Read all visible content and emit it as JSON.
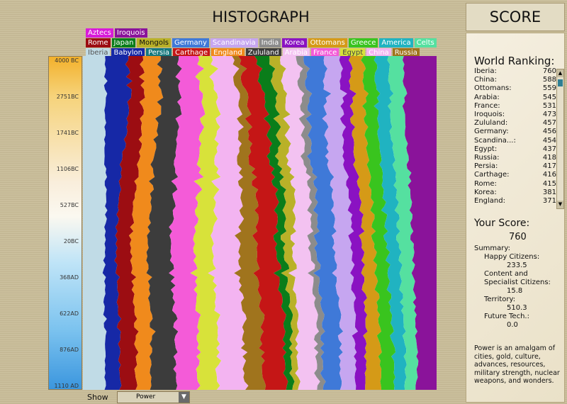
{
  "header": {
    "histograph_title": "HISTOGRAPH",
    "score_title": "SCORE"
  },
  "legend": {
    "row1": [
      {
        "label": "Aztecs",
        "color": "#d81bd8",
        "text": "#ffffff"
      },
      {
        "label": "Iroquois",
        "color": "#8a139a",
        "text": "#ffffff"
      }
    ],
    "row2": [
      {
        "label": "Rome",
        "color": "#9c0d12",
        "text": "#ffffff"
      },
      {
        "label": "Japan",
        "color": "#0a7d1a",
        "text": "#ffffff"
      },
      {
        "label": "Mongols",
        "color": "#b9b128",
        "text": "#111111"
      },
      {
        "label": "Germany",
        "color": "#3f79d8",
        "text": "#ffffff"
      },
      {
        "label": "Scandinavia",
        "color": "#c6a6f0",
        "text": "#ffffff"
      },
      {
        "label": "India",
        "color": "#8c8c8c",
        "text": "#ffffff"
      },
      {
        "label": "Korea",
        "color": "#8a12c2",
        "text": "#ffffff"
      },
      {
        "label": "Ottomans",
        "color": "#d59a17",
        "text": "#ffffff"
      },
      {
        "label": "Greece",
        "color": "#39c41e",
        "text": "#ffffff"
      },
      {
        "label": "America",
        "color": "#20b3c1",
        "text": "#ffffff"
      },
      {
        "label": "Celts",
        "color": "#55e0a0",
        "text": "#ffffff"
      }
    ],
    "row3": [
      {
        "label": "Iberia",
        "color": "#c0dbe6",
        "text": "#555555"
      },
      {
        "label": "Babylon",
        "color": "#1628a6",
        "text": "#ffffff"
      },
      {
        "label": "Persia",
        "color": "#16797e",
        "text": "#ffffff"
      },
      {
        "label": "Carthage",
        "color": "#c51616",
        "text": "#ffffff"
      },
      {
        "label": "England",
        "color": "#f08a1c",
        "text": "#ffffff"
      },
      {
        "label": "Zululand",
        "color": "#3c3c3c",
        "text": "#ffffff"
      },
      {
        "label": "Arabia",
        "color": "#f3c2f1",
        "text": "#ffffff"
      },
      {
        "label": "France",
        "color": "#f45bd8",
        "text": "#ffffff"
      },
      {
        "label": "Egypt",
        "color": "#d8e23a",
        "text": "#444444"
      },
      {
        "label": "China",
        "color": "#f3b4f1",
        "text": "#ffffff"
      },
      {
        "label": "Russia",
        "color": "#a0741d",
        "text": "#ffffff"
      }
    ]
  },
  "chart_data": {
    "type": "area",
    "title": "HISTOGRAPH",
    "x_axis_ticks": [
      "4000 BC",
      "2751BC",
      "1741BC",
      "1106BC",
      "527BC",
      "20BC",
      "368AD",
      "622AD",
      "876AD",
      "1110 AD"
    ],
    "series": [
      {
        "name": "Iberia",
        "color": "#c0dbe6",
        "values": [
          30,
          28,
          27,
          28,
          30,
          29,
          28,
          30,
          31,
          31
        ]
      },
      {
        "name": "Babylon",
        "color": "#1628a6",
        "values": [
          27,
          31,
          28,
          20,
          16,
          15,
          17,
          19,
          19,
          21
        ]
      },
      {
        "name": "Rome",
        "color": "#9c0d12",
        "values": [
          19,
          16,
          18,
          22,
          20,
          19,
          20,
          22,
          23,
          22
        ]
      },
      {
        "name": "England",
        "color": "#f08a1c",
        "values": [
          22,
          22,
          20,
          18,
          22,
          22,
          21,
          22,
          20,
          19
        ]
      },
      {
        "name": "Zululand",
        "color": "#3c3c3c",
        "values": [
          23,
          24,
          26,
          28,
          30,
          30,
          32,
          32,
          33,
          34
        ]
      },
      {
        "name": "France",
        "color": "#f45bd8",
        "values": [
          24,
          28,
          30,
          32,
          30,
          31,
          30,
          31,
          30,
          30
        ]
      },
      {
        "name": "Egypt",
        "color": "#d8e23a",
        "values": [
          16,
          18,
          20,
          22,
          23,
          24,
          24,
          26,
          27,
          28
        ]
      },
      {
        "name": "China",
        "color": "#f3b4f1",
        "values": [
          27,
          28,
          29,
          30,
          33,
          34,
          35,
          36,
          36,
          38
        ]
      },
      {
        "name": "Russia",
        "color": "#a0741d",
        "values": [
          8,
          10,
          12,
          16,
          20,
          22,
          24,
          24,
          25,
          26
        ]
      },
      {
        "name": "Carthage",
        "color": "#c51616",
        "values": [
          20,
          22,
          24,
          25,
          26,
          26,
          28,
          29,
          30,
          30
        ]
      },
      {
        "name": "Japan",
        "color": "#0a7d1a",
        "values": [
          17,
          15,
          12,
          11,
          10,
          10,
          10,
          10,
          9,
          8
        ]
      },
      {
        "name": "Mongols",
        "color": "#b9b128",
        "values": [
          13,
          12,
          12,
          13,
          13,
          12,
          10,
          8,
          8,
          8
        ]
      },
      {
        "name": "Arabia",
        "color": "#f3c2f1",
        "values": [
          20,
          20,
          19,
          20,
          20,
          22,
          24,
          25,
          26,
          26
        ]
      },
      {
        "name": "India",
        "color": "#8c8c8c",
        "values": [
          9,
          9,
          9,
          8,
          8,
          8,
          8,
          8,
          8,
          8
        ]
      },
      {
        "name": "Germany",
        "color": "#3f79d8",
        "values": [
          24,
          22,
          20,
          22,
          22,
          23,
          23,
          23,
          24,
          24
        ]
      },
      {
        "name": "Scandinavia",
        "color": "#c6a6f0",
        "values": [
          20,
          20,
          21,
          20,
          22,
          22,
          22,
          20,
          20,
          20
        ]
      },
      {
        "name": "Korea",
        "color": "#8a12c2",
        "values": [
          12,
          12,
          12,
          14,
          14,
          14,
          14,
          14,
          14,
          14
        ]
      },
      {
        "name": "Ottomans",
        "color": "#d59a17",
        "values": [
          16,
          16,
          17,
          16,
          15,
          15,
          17,
          18,
          20,
          21
        ]
      },
      {
        "name": "Greece",
        "color": "#39c41e",
        "values": [
          15,
          15,
          16,
          16,
          15,
          16,
          16,
          17,
          18,
          18
        ]
      },
      {
        "name": "America",
        "color": "#20b3c1",
        "values": [
          16,
          16,
          16,
          17,
          16,
          16,
          16,
          16,
          16,
          15
        ]
      },
      {
        "name": "Celts",
        "color": "#55e0a0",
        "values": [
          18,
          18,
          18,
          18,
          18,
          18,
          17,
          17,
          16,
          16
        ]
      },
      {
        "name": "Iroquois",
        "color": "#8a139a",
        "values": [
          40,
          40,
          38,
          36,
          33,
          32,
          30,
          28,
          27,
          27
        ]
      }
    ]
  },
  "show": {
    "label": "Show",
    "value": "Power"
  },
  "ranking": {
    "title": "World Ranking:",
    "rows": [
      {
        "name": "Iberia:",
        "score": "760"
      },
      {
        "name": "China:",
        "score": "588"
      },
      {
        "name": "Ottomans:",
        "score": "559"
      },
      {
        "name": "Arabia:",
        "score": "545"
      },
      {
        "name": "France:",
        "score": "531"
      },
      {
        "name": "Iroquois:",
        "score": "473"
      },
      {
        "name": "Zululand:",
        "score": "457"
      },
      {
        "name": "Germany:",
        "score": "456"
      },
      {
        "name": "Scandina...:",
        "score": "454"
      },
      {
        "name": "Egypt:",
        "score": "437"
      },
      {
        "name": "Russia:",
        "score": "418"
      },
      {
        "name": "Persia:",
        "score": "417"
      },
      {
        "name": "Carthage:",
        "score": "416"
      },
      {
        "name": "Rome:",
        "score": "415"
      },
      {
        "name": "Korea:",
        "score": "381"
      },
      {
        "name": "England:",
        "score": "371"
      }
    ]
  },
  "your_score": {
    "label": "Your Score:",
    "value": "760",
    "summary_label": "Summary:",
    "happy_label": "Happy Citizens:",
    "happy_value": "233.5",
    "content_label": "Content and Specialist Citizens:",
    "content_value": "15.8",
    "territory_label": "Territory:",
    "territory_value": "510.3",
    "future_label": "Future Tech.:",
    "future_value": "0.0"
  },
  "power_note": "Power is an amalgam of cities, gold, culture, advances, resources, military strength, nuclear weapons, and wonders."
}
